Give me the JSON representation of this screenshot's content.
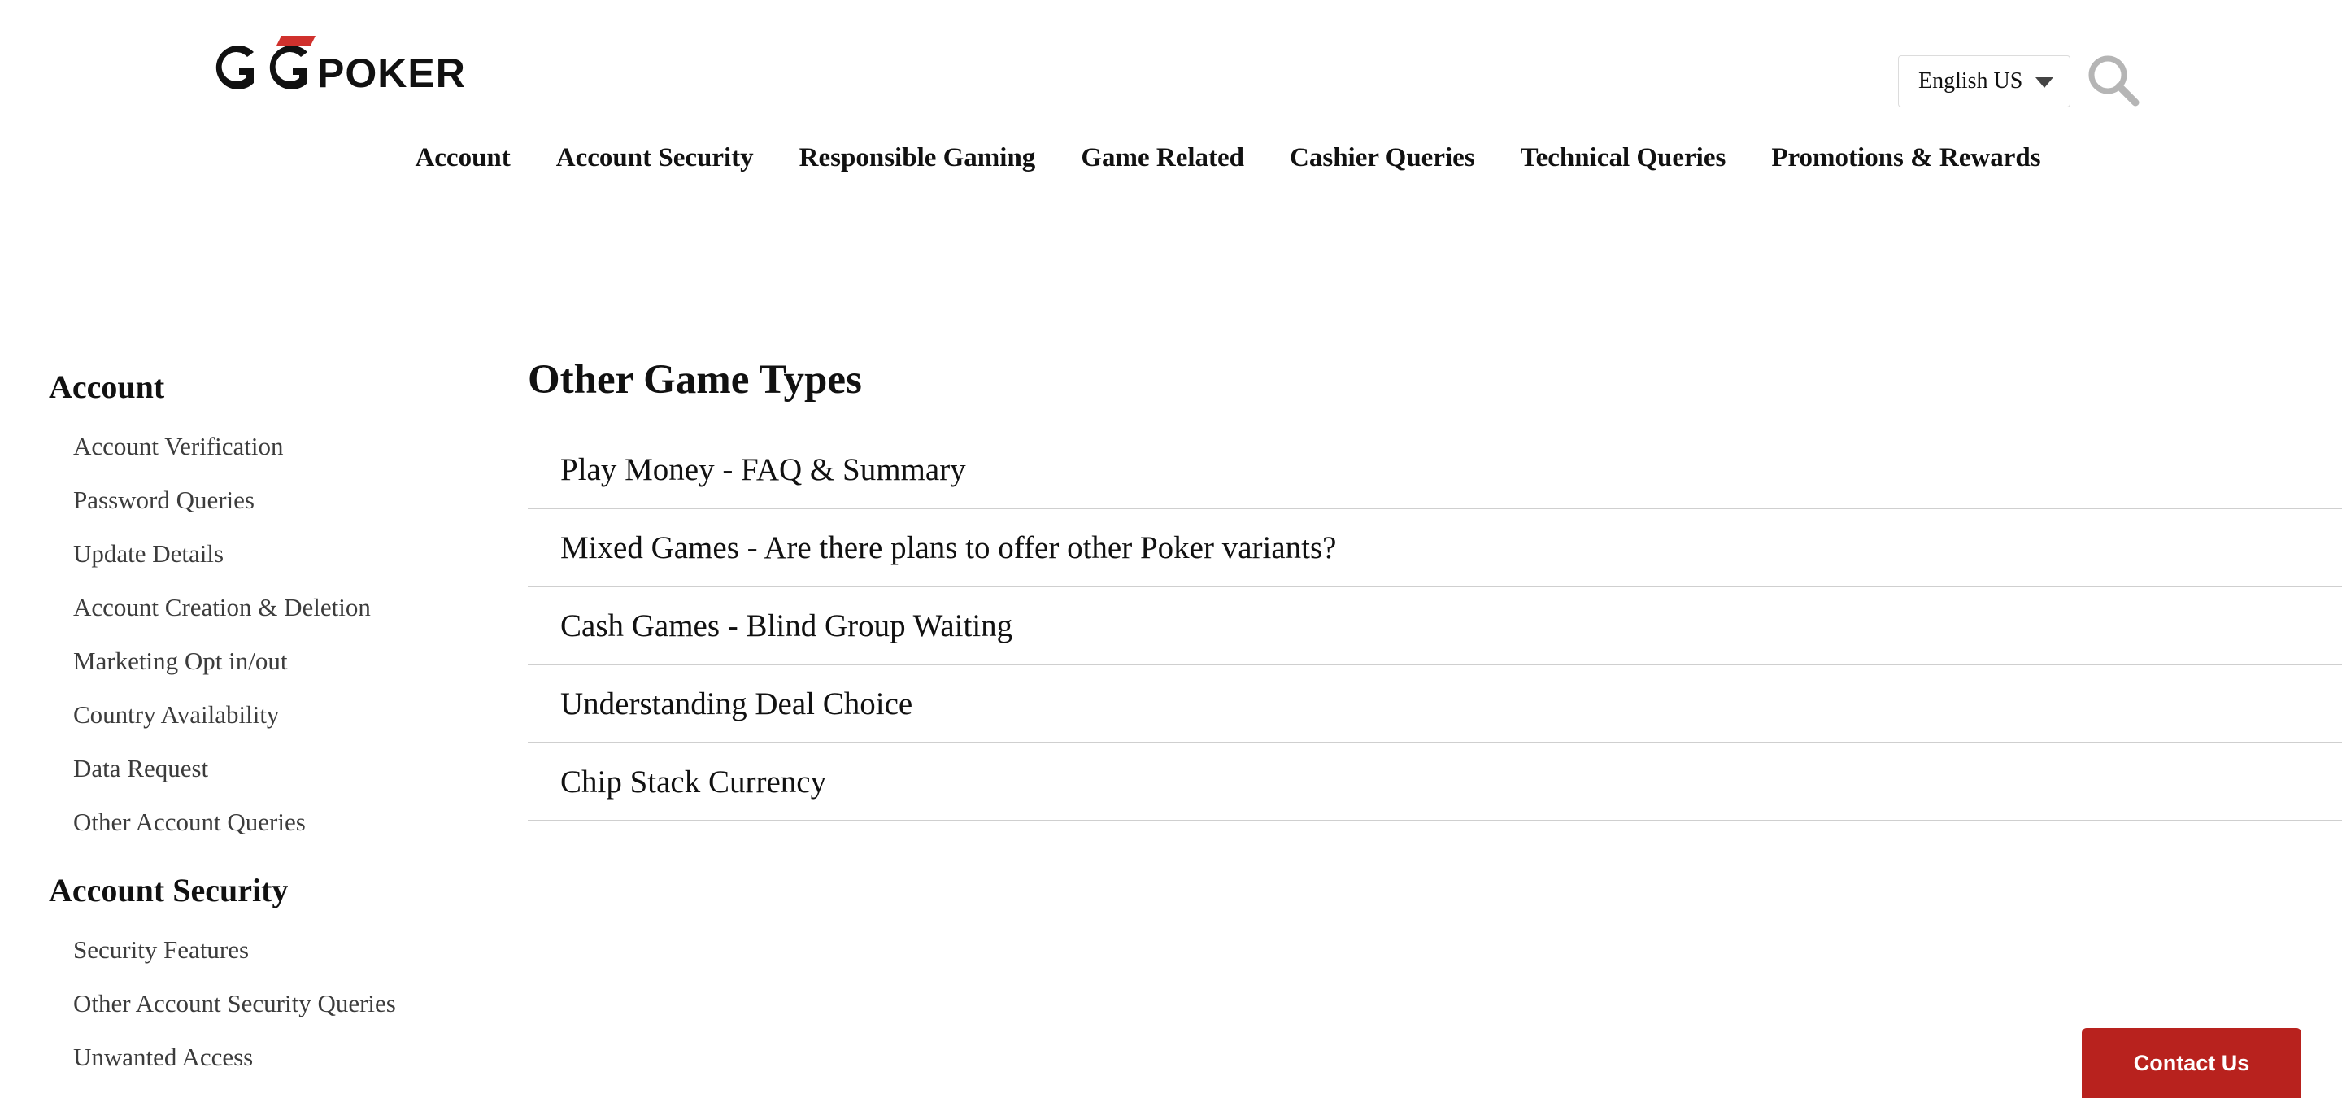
{
  "brand": {
    "logo_text": "GGPOKER",
    "logo_suffix": "POKER",
    "accent_color": "#d0312d"
  },
  "header": {
    "language": {
      "selected": "English US",
      "icon": "chevron-down-icon"
    },
    "search": {
      "icon": "search-icon"
    }
  },
  "nav": {
    "items": [
      {
        "label": "Account"
      },
      {
        "label": "Account Security"
      },
      {
        "label": "Responsible Gaming"
      },
      {
        "label": "Game Related"
      },
      {
        "label": "Cashier Queries"
      },
      {
        "label": "Technical Queries"
      },
      {
        "label": "Promotions & Rewards"
      }
    ]
  },
  "sidebar": {
    "sections": [
      {
        "heading": "Account",
        "items": [
          {
            "label": "Account Verification"
          },
          {
            "label": "Password Queries"
          },
          {
            "label": "Update Details"
          },
          {
            "label": "Account Creation & Deletion"
          },
          {
            "label": "Marketing Opt in/out"
          },
          {
            "label": "Country Availability"
          },
          {
            "label": "Data Request"
          },
          {
            "label": "Other Account Queries"
          }
        ]
      },
      {
        "heading": "Account Security",
        "items": [
          {
            "label": "Security Features"
          },
          {
            "label": "Other Account Security Queries"
          },
          {
            "label": "Unwanted Access"
          }
        ]
      }
    ]
  },
  "main": {
    "title": "Other Game Types",
    "articles": [
      {
        "label": "Play Money - FAQ & Summary"
      },
      {
        "label": "Mixed Games - Are there plans to offer other Poker variants?"
      },
      {
        "label": "Cash Games - Blind Group Waiting"
      },
      {
        "label": "Understanding Deal Choice"
      },
      {
        "label": "Chip Stack Currency"
      }
    ]
  },
  "contact": {
    "label": "Contact Us",
    "color": "#b8221e"
  }
}
